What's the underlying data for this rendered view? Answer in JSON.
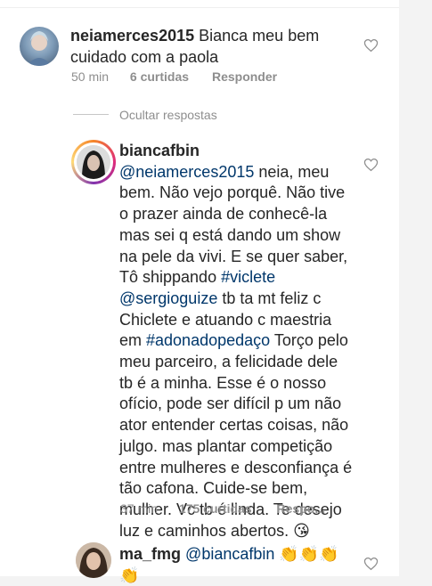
{
  "comments": [
    {
      "username": "neiamerces2015",
      "text": "Bianca meu bem cuidado com a paola",
      "time": "50 min",
      "likes": "6 curtidas",
      "reply": "Responder"
    }
  ],
  "hide_replies": "Ocultar respostas",
  "reply_comment": {
    "username": "biancafbin",
    "mention": "@neiamerces2015",
    "text1": " neia, meu bem. Não vejo porquê. Não tive o prazer ainda de conhecê-la mas sei q está dando um show na pele da vivi. E se quer saber, Tô shippando ",
    "hashtag1": "#viclete",
    "mention2": "@sergioguize",
    "text2": " tb ta mt feliz c Chiclete e atuando c maestria em ",
    "hashtag2": "#adonadopedaço",
    "text3": " Torço pelo meu parceiro, a felicidade dele tb é a minha.  Esse é o nosso ofício, pode ser difícil p um não ator entender certas coisas, não julgo. mas plantar competição entre mulheres e desconfiança é tão cafona. Cuide-se bem, mulher. Vc tb é linda. Te desejo luz e caminhos abertos. ",
    "emoji": "😘",
    "time": "37 min",
    "likes": "175 curtidas",
    "reply": "Respo..."
  },
  "last_comment": {
    "username": "ma_fmg",
    "mention": "@biancafbin",
    "emojis": "👏👏👏",
    "emoji2": "👏"
  },
  "colors": {
    "link": "#00376b",
    "meta": "#8e8e8e",
    "text": "#262626"
  },
  "icons": [
    "heart-icon"
  ]
}
